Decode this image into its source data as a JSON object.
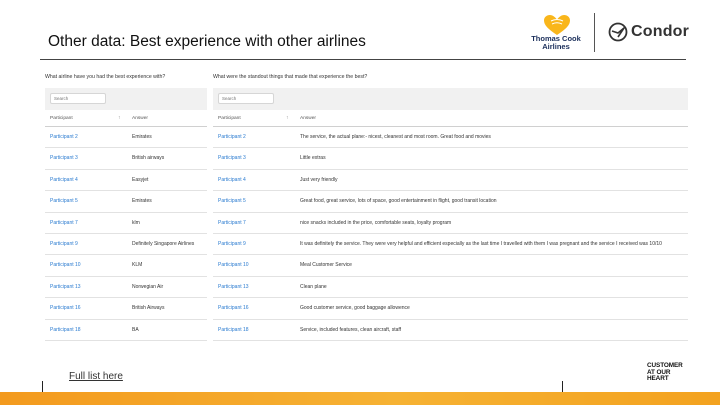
{
  "slide": {
    "title": "Other data: Best experience with other airlines",
    "full_list_link": "Full list here"
  },
  "logos": {
    "thomas_cook_line1": "Thomas Cook",
    "thomas_cook_line2": "Airlines",
    "condor": "Condor",
    "tagline_line1": "CUSTOMER",
    "tagline_line2": "AT OUR",
    "tagline_line3": "HEART",
    "colors": {
      "thomas_cook_heart": "#f9b61b",
      "thomas_cook_text": "#1a2e5a",
      "stripe": "#f39a1e"
    }
  },
  "left_panel": {
    "question": "What airline have you had the best experience with?",
    "search_placeholder": "Search",
    "columns": {
      "participant": "Participant",
      "answer": "Answer"
    },
    "rows": [
      {
        "participant": "Participant 2",
        "answer": "Emirates"
      },
      {
        "participant": "Participant 3",
        "answer": "British airways"
      },
      {
        "participant": "Participant 4",
        "answer": "Easyjet"
      },
      {
        "participant": "Participant 5",
        "answer": "Emirates"
      },
      {
        "participant": "Participant 7",
        "answer": "klm"
      },
      {
        "participant": "Participant 9",
        "answer": "Definitely Singapore Airlines"
      },
      {
        "participant": "Participant 10",
        "answer": "KLM"
      },
      {
        "participant": "Participant 13",
        "answer": "Norwegian Air"
      },
      {
        "participant": "Participant 16",
        "answer": "British Airways"
      },
      {
        "participant": "Participant 18",
        "answer": "BA"
      }
    ]
  },
  "right_panel": {
    "question": "What were the standout things that made that experience the best?",
    "search_placeholder": "Search",
    "columns": {
      "participant": "Participant",
      "answer": "Answer"
    },
    "rows": [
      {
        "participant": "Participant 2",
        "answer": "The service, the actual plane:- nicest, cleanest and most room. Great food and movies"
      },
      {
        "participant": "Participant 3",
        "answer": "Little extras"
      },
      {
        "participant": "Participant 4",
        "answer": "Just very friendly"
      },
      {
        "participant": "Participant 5",
        "answer": "Great food, great service, lots of space, good entertainment in flight, good transit location"
      },
      {
        "participant": "Participant 7",
        "answer": "nice snacks included in the price, comfortable seats, loyalty program"
      },
      {
        "participant": "Participant 9",
        "answer": "It was definitely the service. They were very helpful and efficient especially as the last time I travelled with them I was pregnant and the service I received was 10/10"
      },
      {
        "participant": "Participant 10",
        "answer": "Meal Customer Service"
      },
      {
        "participant": "Participant 13",
        "answer": "Clean plane"
      },
      {
        "participant": "Participant 16",
        "answer": "Good customer service, good baggage allowence"
      },
      {
        "participant": "Participant 18",
        "answer": "Service, included features, clean aircraft, staff"
      }
    ]
  }
}
